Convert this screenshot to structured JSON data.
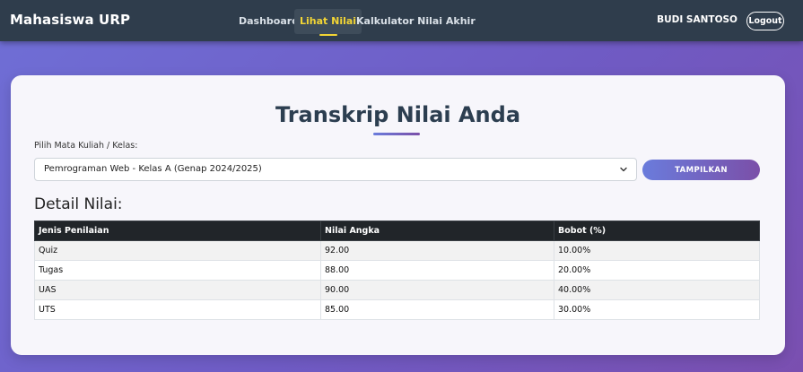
{
  "navbar": {
    "brand": "Mahasiswa URP",
    "links": [
      {
        "label": "Dashboard",
        "active": false
      },
      {
        "label": "Lihat Nilai",
        "active": true
      },
      {
        "label": "Kalkulator Nilai Akhir",
        "active": false
      }
    ],
    "username": "BUDI SANTOSO",
    "logout_label": "Logout"
  },
  "main": {
    "title": "Transkrip Nilai Anda",
    "select_label": "Pilih Mata Kuliah / Kelas:",
    "selected_course": "Pemrograman Web - Kelas A (Genap 2024/2025)",
    "show_button_label": "TAMPILKAN",
    "detail_heading": "Detail Nilai:",
    "table": {
      "headers": [
        "Jenis Penilaian",
        "Nilai Angka",
        "Bobot (%)"
      ],
      "rows": [
        [
          "Quiz",
          "92.00",
          "10.00%"
        ],
        [
          "Tugas",
          "88.00",
          "20.00%"
        ],
        [
          "UAS",
          "90.00",
          "40.00%"
        ],
        [
          "UTS",
          "85.00",
          "30.00%"
        ]
      ]
    }
  },
  "colors": {
    "navbar_bg": "#2f3d4c",
    "active_link": "#f2d535",
    "accent_gradient_start": "#6a7cdc",
    "accent_gradient_end": "#7b4fa8",
    "table_header_bg": "#212529"
  }
}
